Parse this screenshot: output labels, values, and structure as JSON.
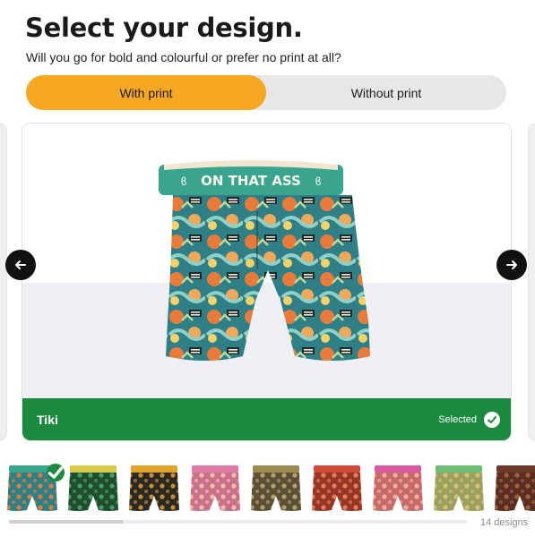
{
  "header": {
    "title": "Select your design.",
    "subtitle": "Will you go for bold and colourful or prefer no print at all?"
  },
  "toggle": {
    "options": [
      {
        "label": "With print",
        "active": true
      },
      {
        "label": "Without print",
        "active": false
      }
    ],
    "accent_color": "#f7a823"
  },
  "product": {
    "waistband_text": "ON THAT ASS",
    "waistband_color": "#3aa58f"
  },
  "selection": {
    "design_name": "Tiki",
    "selected_label": "Selected",
    "selected_color": "#1b8a3f"
  },
  "icons": {
    "prev": "arrow-left-icon",
    "next": "arrow-right-icon",
    "selected": "check-circle-icon"
  },
  "thumbnails": [
    {
      "waist": "#3aa58f",
      "base": "#2f7f86",
      "accent": "#e87b3a",
      "selected": true
    },
    {
      "waist": "#d9c94a",
      "base": "#1f4d2e",
      "accent": "#3fa060",
      "selected": false
    },
    {
      "waist": "#e0a42a",
      "base": "#2a2a24",
      "accent": "#c98b2e",
      "selected": false
    },
    {
      "waist": "#e07aa6",
      "base": "#c9708b",
      "accent": "#f2c0a8",
      "selected": false
    },
    {
      "waist": "#9b8a52",
      "base": "#5b5036",
      "accent": "#b2a06a",
      "selected": false
    },
    {
      "waist": "#d04a3a",
      "base": "#9a3424",
      "accent": "#e08060",
      "selected": false
    },
    {
      "waist": "#d95a9c",
      "base": "#c66a6a",
      "accent": "#f0b0a0",
      "selected": false
    },
    {
      "waist": "#6dbd72",
      "base": "#9aa060",
      "accent": "#d8c070",
      "selected": false
    },
    {
      "waist": "#6a3a2a",
      "base": "#5a2e22",
      "accent": "#a0603a",
      "selected": false
    }
  ],
  "footer": {
    "count_label": "14 designs",
    "scroll_progress": 0.25
  }
}
